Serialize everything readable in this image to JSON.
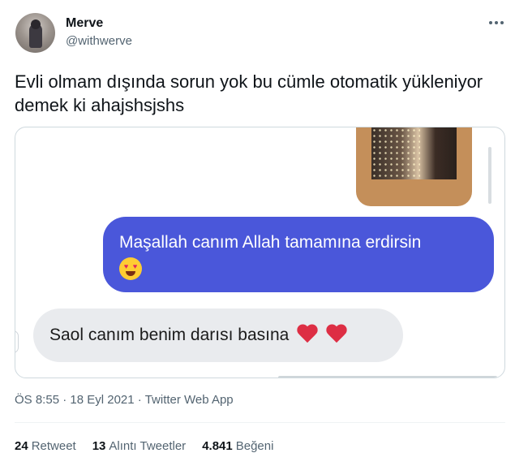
{
  "user": {
    "display_name": "Merve",
    "handle": "@withwerve"
  },
  "tweet": {
    "text": "Evli olmam dışında sorun yok bu cümle otomatik yükleniyor demek ki ahajshsjshs"
  },
  "chat": {
    "sent_message": "Maşallah canım Allah tamamına erdirsin",
    "sent_emoji_icon": "smiling-face-with-heart-eyes",
    "received_message": "Saol canım benim darısı basına",
    "received_emoji_icons": [
      "red-heart",
      "red-heart"
    ],
    "sent_bubble_color": "#4a57da",
    "received_bubble_color": "#e9ebee",
    "photo_frame_color": "#c48f5a"
  },
  "meta": {
    "time": "ÖS 8:55",
    "sep1": " · ",
    "date": "18 Eyl 2021",
    "sep2": " · ",
    "source": "Twitter Web App"
  },
  "stats": {
    "retweets_count": "24",
    "retweets_label": "Retweet",
    "quotes_count": "13",
    "quotes_label": "Alıntı Tweetler",
    "likes_count": "4.841",
    "likes_label": "Beğeni"
  },
  "icons": {
    "more": "more-horizontal-icon"
  }
}
